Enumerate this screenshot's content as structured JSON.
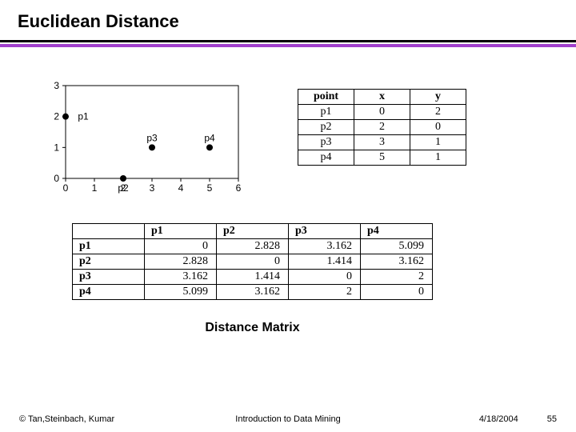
{
  "title": "Euclidean Distance",
  "matrix_caption": "Distance Matrix",
  "footer": {
    "copyright": "© Tan,Steinbach, Kumar",
    "center": "Introduction to Data Mining",
    "date": "4/18/2004",
    "page": "55"
  },
  "coord_table": {
    "headers": [
      "point",
      "x",
      "y"
    ],
    "rows": [
      [
        "p1",
        "0",
        "2"
      ],
      [
        "p2",
        "2",
        "0"
      ],
      [
        "p3",
        "3",
        "1"
      ],
      [
        "p4",
        "5",
        "1"
      ]
    ]
  },
  "distance_table": {
    "col_headers": [
      "p1",
      "p2",
      "p3",
      "p4"
    ],
    "row_headers": [
      "p1",
      "p2",
      "p3",
      "p4"
    ],
    "cells": [
      [
        "0",
        "2.828",
        "3.162",
        "5.099"
      ],
      [
        "2.828",
        "0",
        "1.414",
        "3.162"
      ],
      [
        "3.162",
        "1.414",
        "0",
        "2"
      ],
      [
        "5.099",
        "3.162",
        "2",
        "0"
      ]
    ]
  },
  "chart_data": {
    "type": "scatter",
    "title": "",
    "xlabel": "",
    "ylabel": "",
    "xlim": [
      0,
      6
    ],
    "ylim": [
      0,
      3
    ],
    "xticks": [
      0,
      1,
      2,
      3,
      4,
      5,
      6
    ],
    "yticks": [
      0,
      1,
      2,
      3
    ],
    "points": [
      {
        "name": "p1",
        "x": 0,
        "y": 2
      },
      {
        "name": "p2",
        "x": 2,
        "y": 0
      },
      {
        "name": "p3",
        "x": 3,
        "y": 1
      },
      {
        "name": "p4",
        "x": 5,
        "y": 1
      }
    ]
  }
}
